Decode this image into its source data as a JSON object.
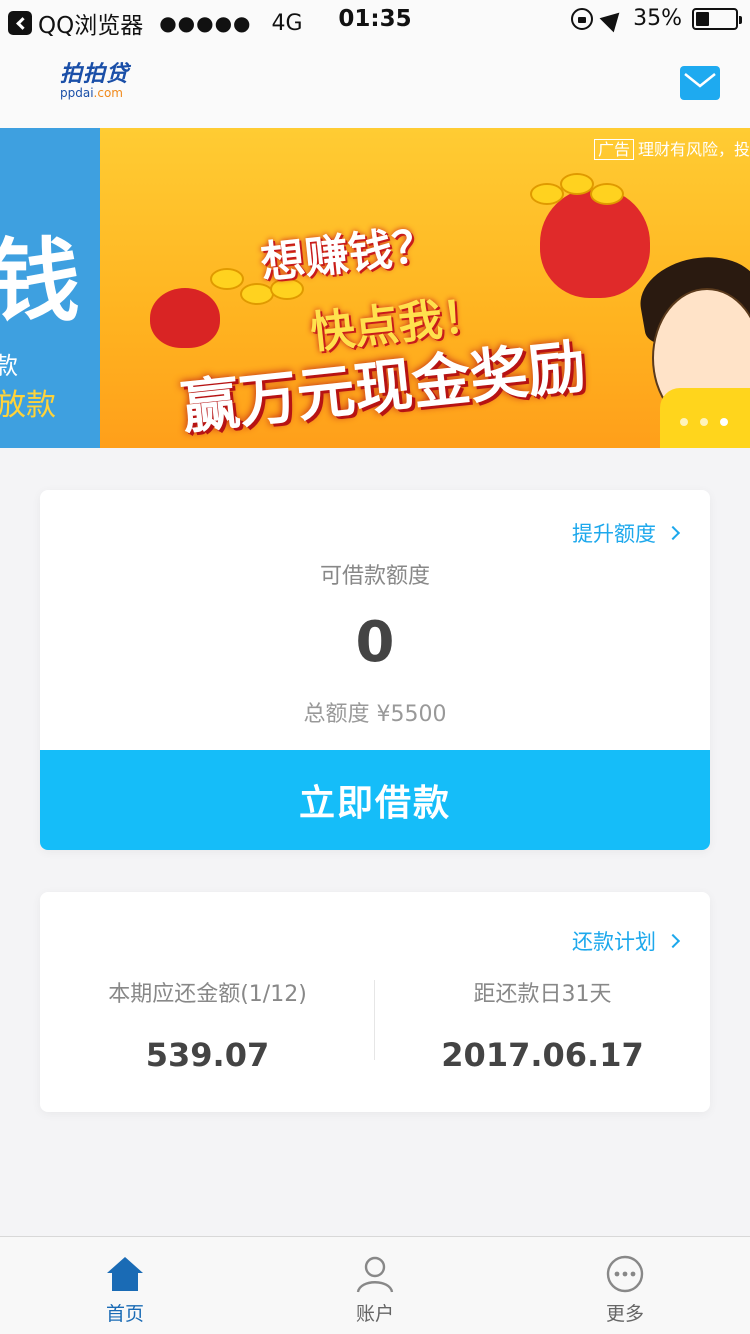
{
  "status_bar": {
    "app": "QQ浏览器",
    "signal": "●●●●●",
    "network": "4G",
    "time": "01:35",
    "battery": "35%",
    "battery_level": 0.35
  },
  "header": {
    "logo_cn": "拍拍贷",
    "logo_en_main": "ppdai",
    "logo_en_suffix": ".com",
    "mail_icon": "envelope-icon"
  },
  "banner": {
    "left_partial_big": "钱",
    "left_partial_line1": "款",
    "left_partial_line2": "放款",
    "ad_tag": "广告",
    "ad_note": "理财有风险，投",
    "line1": "想赚钱？",
    "line2": "快点我！",
    "line3": "赢万元现金奖励",
    "slides": 3,
    "active_slide": 2
  },
  "credit_card": {
    "raise_limit": "提升额度",
    "available_label": "可借款额度",
    "available_value": "0",
    "total_label": "总额度 ¥5500",
    "borrow_button": "立即借款"
  },
  "repay_card": {
    "plan_link": "还款计划",
    "due_label": "本期应还金额(1/12)",
    "due_value": "539.07",
    "days_label": "距还款日31天",
    "date_value": "2017.06.17"
  },
  "tabbar": {
    "items": [
      {
        "label": "首页",
        "icon": "home-icon",
        "active": true
      },
      {
        "label": "账户",
        "icon": "user-icon",
        "active": false
      },
      {
        "label": "更多",
        "icon": "more-icon",
        "active": false
      }
    ]
  },
  "colors": {
    "accent": "#15bdf9",
    "link": "#1da8ec",
    "tab_active": "#1a6bb5"
  }
}
